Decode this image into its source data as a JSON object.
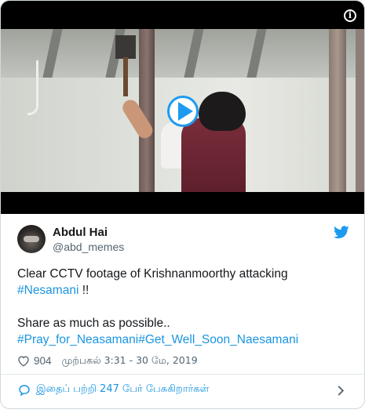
{
  "embed": {
    "video": {
      "info_label": "i",
      "play_label": "Play video"
    },
    "author": {
      "name": "Abdul Hai",
      "handle": "@abd_memes"
    },
    "tweet": {
      "line1": "Clear CCTV footage of Krishnanmoorthy attacking",
      "hashtag1": "#Nesamani",
      "after_hashtag1": " !!",
      "line3": "Share as much as possible..",
      "hashtag2": "#Pray_for_Neasamani",
      "hashtag3": "#Get_Well_Soon_Naesamani"
    },
    "meta": {
      "likes": "904",
      "timestamp": "முற்பகல் 3:31 - 30 மே, 2019"
    },
    "footer": {
      "text": "இதைப் பற்றி 247 பேர் பேசுகிறார்கள்"
    }
  },
  "colors": {
    "link": "#1b95e0",
    "accent": "#1d9bf0",
    "muted": "#536471",
    "text": "#14171a"
  },
  "icons": {
    "info": "info-icon",
    "play": "play-icon",
    "bird": "twitter-bird-icon",
    "heart": "heart-icon",
    "bubble": "speech-bubble-icon",
    "chevron": "chevron-right-icon"
  }
}
